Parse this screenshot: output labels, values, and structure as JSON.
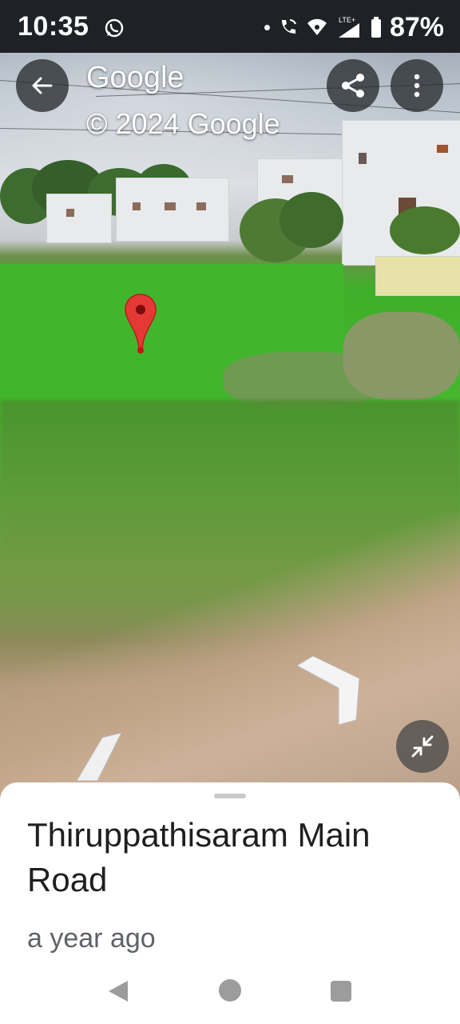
{
  "status_bar": {
    "time": "10:35",
    "battery": "87%",
    "icons": [
      "whatsapp-icon",
      "notification-dot",
      "wifi-call-icon",
      "wifi-icon",
      "lte-signal-icon",
      "battery-icon"
    ],
    "lte_label": "LTE+"
  },
  "header": {
    "brand": "Google",
    "copyright": "© 2024 Google",
    "back_icon": "arrow-left-icon",
    "share_icon": "share-icon",
    "more_icon": "more-vert-icon"
  },
  "street_view": {
    "marker_color": "#e53935",
    "watermark": "© 2024 Google"
  },
  "bottom_sheet": {
    "title": "Thiruppathisaram Main Road",
    "subtitle": "a year ago"
  },
  "navigation_bar": {
    "icons": [
      "nav-back-icon",
      "nav-home-icon",
      "nav-recents-icon"
    ]
  },
  "colors": {
    "status_bar_bg": "#1e2226",
    "marker": "#e53935",
    "sheet_bg": "#ffffff",
    "title_text": "#1f1f1f",
    "subtitle_text": "#5f6368"
  }
}
